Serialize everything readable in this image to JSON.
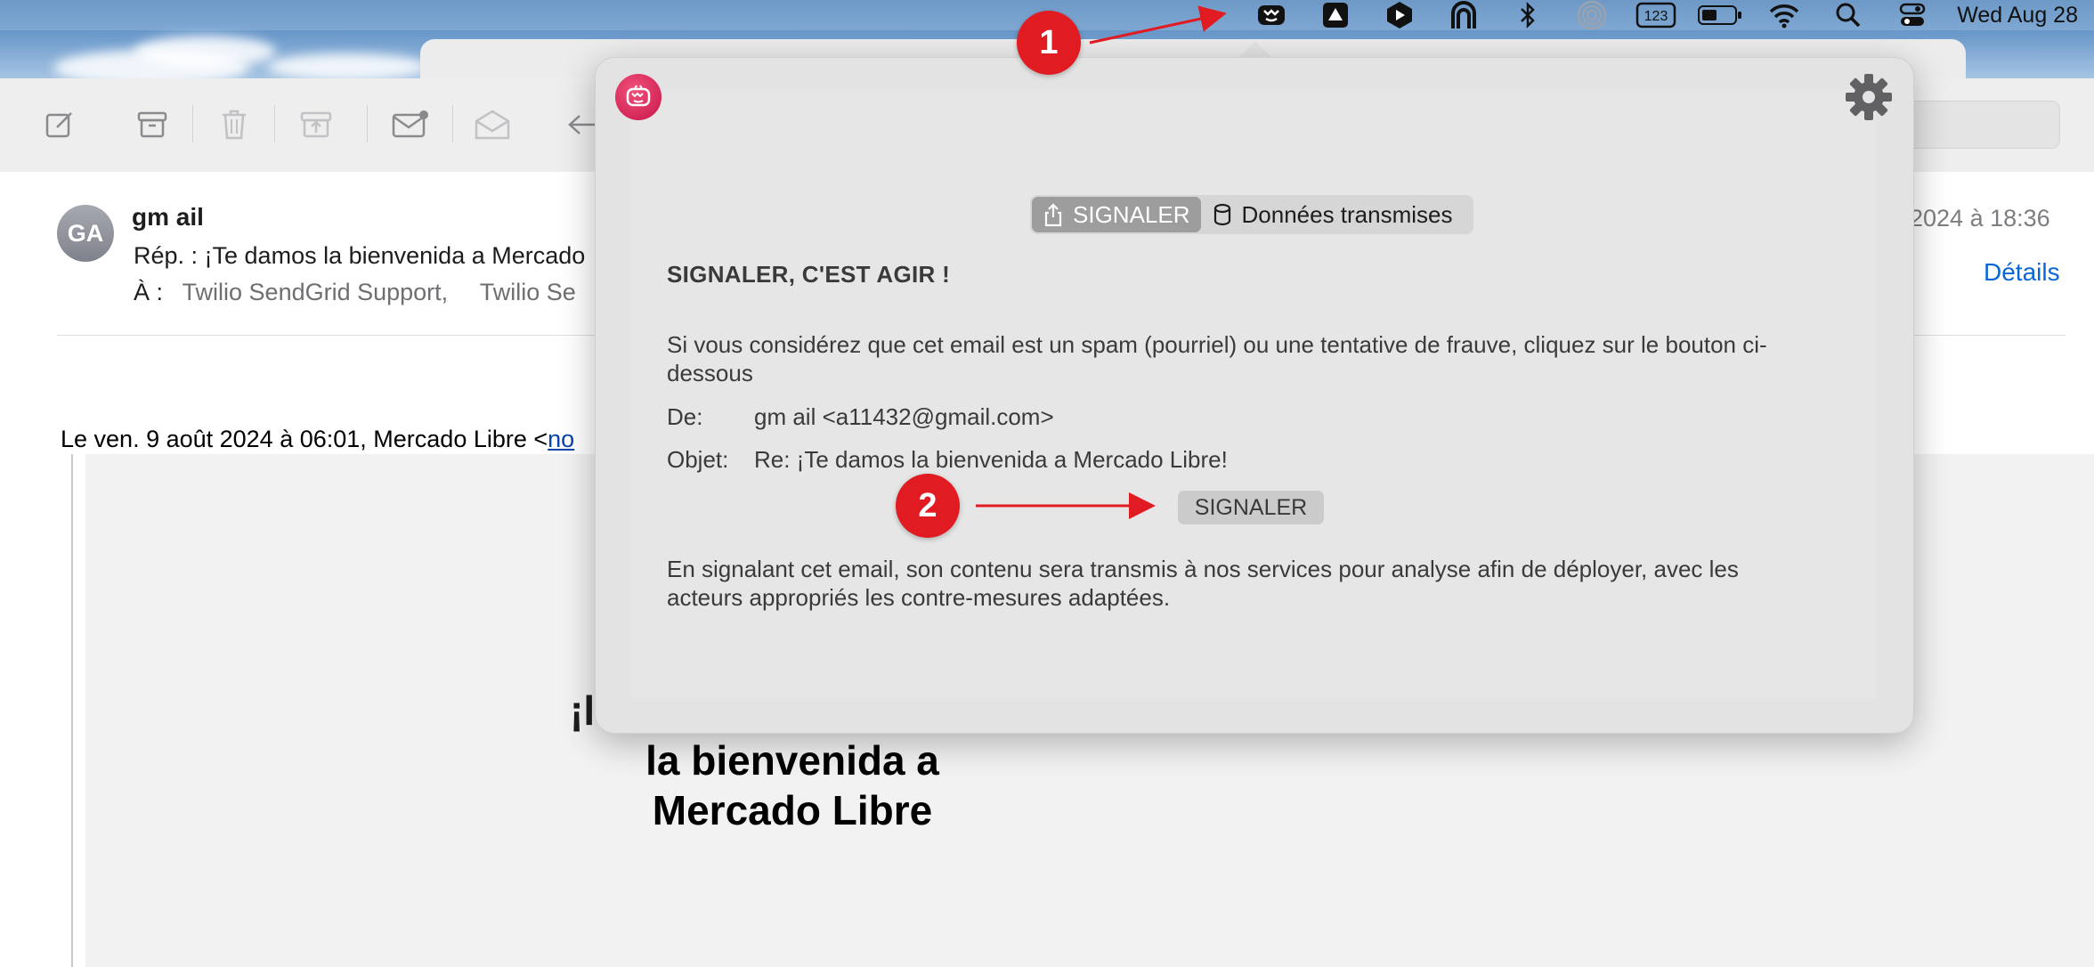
{
  "menubar": {
    "clock": "Wed Aug 28",
    "icons": [
      "cyber-report-app-icon",
      "drive-icon",
      "dictionary-app-icon",
      "vpn-icon",
      "bluetooth-icon",
      "airdrop-icon",
      "input-123-icon",
      "battery-icon",
      "wifi-icon",
      "spotlight-search-icon",
      "control-center-icon"
    ]
  },
  "mail": {
    "avatar_initials": "GA",
    "sender": "gm ail",
    "subject": "Rép. : ¡Te damos la bienvenida a Mercado",
    "to_label": "À :",
    "recipients": [
      "Twilio SendGrid Support,",
      "Twilio Se"
    ],
    "date_fragment": "t 2024 à 18:36",
    "details_link": "Détails",
    "quote_intro": "Le ven. 9 août 2024 à 06:01, Mercado Libre <",
    "quote_link": "no",
    "welcome_partial": "¡l",
    "welcome_line2": "la bienvenida a",
    "welcome_line3": "Mercado Libre"
  },
  "popover": {
    "tabs": [
      {
        "label": "SIGNALER",
        "active": true
      },
      {
        "label": "Données transmises",
        "active": false
      }
    ],
    "title": "SIGNALER, C'EST AGIR !",
    "description": "Si vous considérez que cet email est un spam (pourriel) ou une tentative de frauve, cliquez sur le bouton ci-dessous",
    "from_label": "De:",
    "from_value": "gm ail <a11432@gmail.com>",
    "subject_label": "Objet:",
    "subject_value": "Re: ¡Te damos la bienvenida a Mercado Libre!",
    "report_button": "SIGNALER",
    "footer": "En signalant cet email, son contenu sera transmis à nos services pour analyse afin de déployer, avec les acteurs appropriés les contre-mesures adaptées."
  },
  "annotations": {
    "step1": "1",
    "step2": "2",
    "color": "#e01b22"
  }
}
